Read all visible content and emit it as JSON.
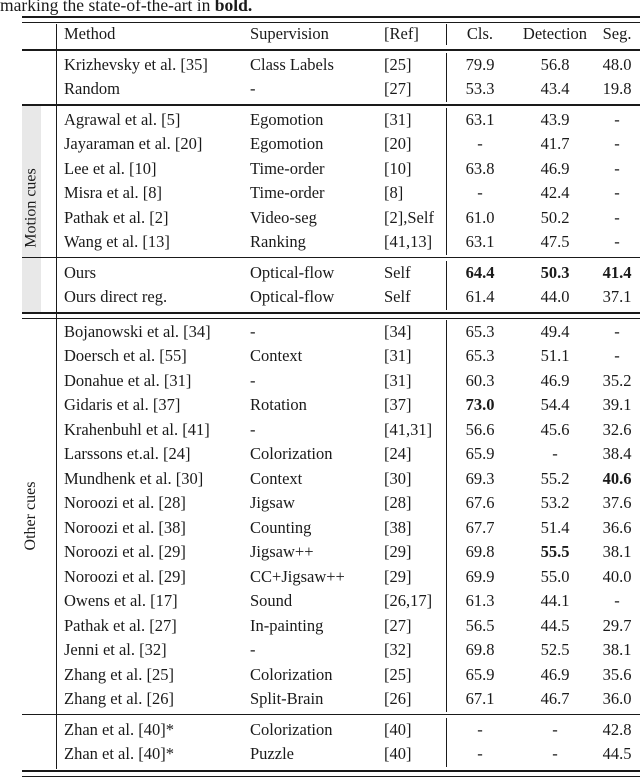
{
  "caption": {
    "prefix": "marking the state-of-the-art in ",
    "bold": "bold."
  },
  "table": {
    "columns": {
      "method": "Method",
      "supervision": "Supervision",
      "ref": "[Ref]",
      "cls": "Cls.",
      "detection": "Detection",
      "seg": "Seg."
    },
    "group_labels": {
      "motion": "Motion cues",
      "other": "Other cues"
    },
    "sections": [
      {
        "id": "supervised-baseline",
        "group": "",
        "rows": [
          {
            "method": "Krizhevsky et al. [35]",
            "supervision": "Class Labels",
            "ref": "[25]",
            "cls": "79.9",
            "detection": "56.8",
            "seg": "48.0",
            "bold": []
          },
          {
            "method": "Random",
            "supervision": "-",
            "ref": "[27]",
            "cls": "53.3",
            "detection": "43.4",
            "seg": "19.8",
            "bold": []
          }
        ]
      },
      {
        "id": "motion-cues",
        "group": "motion",
        "rows": [
          {
            "method": "Agrawal et al. [5]",
            "supervision": "Egomotion",
            "ref": "[31]",
            "cls": "63.1",
            "detection": "43.9",
            "seg": "-",
            "bold": []
          },
          {
            "method": "Jayaraman et al. [20]",
            "supervision": "Egomotion",
            "ref": "[20]",
            "cls": "-",
            "detection": "41.7",
            "seg": "-",
            "bold": []
          },
          {
            "method": "Lee et al. [10]",
            "supervision": "Time-order",
            "ref": "[10]",
            "cls": "63.8",
            "detection": "46.9",
            "seg": "-",
            "bold": []
          },
          {
            "method": "Misra et al. [8]",
            "supervision": "Time-order",
            "ref": "[8]",
            "cls": "-",
            "detection": "42.4",
            "seg": "-",
            "bold": []
          },
          {
            "method": "Pathak et al. [2]",
            "supervision": "Video-seg",
            "ref": "[2],Self",
            "cls": "61.0",
            "detection": "50.2",
            "seg": "-",
            "bold": []
          },
          {
            "method": "Wang et al. [13]",
            "supervision": "Ranking",
            "ref": "[41,13]",
            "cls": "63.1",
            "detection": "47.5",
            "seg": "-",
            "bold": []
          }
        ]
      },
      {
        "id": "ours",
        "group": "motion",
        "rows": [
          {
            "method": "Ours",
            "supervision": "Optical-flow",
            "ref": "Self",
            "cls": "64.4",
            "detection": "50.3",
            "seg": "41.4",
            "bold": [
              "cls",
              "detection",
              "seg"
            ]
          },
          {
            "method": "Ours direct reg.",
            "supervision": "Optical-flow",
            "ref": "Self",
            "cls": "61.4",
            "detection": "44.0",
            "seg": "37.1",
            "bold": []
          }
        ]
      },
      {
        "id": "other-cues",
        "group": "other",
        "rows": [
          {
            "method": "Bojanowski et al. [34]",
            "supervision": "-",
            "ref": "[34]",
            "cls": "65.3",
            "detection": "49.4",
            "seg": "-",
            "bold": []
          },
          {
            "method": "Doersch et al. [55]",
            "supervision": "Context",
            "ref": "[31]",
            "cls": "65.3",
            "detection": "51.1",
            "seg": "-",
            "bold": []
          },
          {
            "method": "Donahue et al. [31]",
            "supervision": "-",
            "ref": "[31]",
            "cls": "60.3",
            "detection": "46.9",
            "seg": "35.2",
            "bold": []
          },
          {
            "method": "Gidaris et al. [37]",
            "supervision": "Rotation",
            "ref": "[37]",
            "cls": "73.0",
            "detection": "54.4",
            "seg": "39.1",
            "bold": [
              "cls"
            ]
          },
          {
            "method": "Krahenbuhl et al. [41]",
            "supervision": "-",
            "ref": "[41,31]",
            "cls": "56.6",
            "detection": "45.6",
            "seg": "32.6",
            "bold": []
          },
          {
            "method": "Larssons et.al. [24]",
            "supervision": "Colorization",
            "ref": "[24]",
            "cls": "65.9",
            "detection": "-",
            "seg": "38.4",
            "bold": []
          },
          {
            "method": "Mundhenk et al. [30]",
            "supervision": "Context",
            "ref": "[30]",
            "cls": "69.3",
            "detection": "55.2",
            "seg": "40.6",
            "bold": [
              "seg"
            ]
          },
          {
            "method": "Noroozi et al. [28]",
            "supervision": "Jigsaw",
            "ref": "[28]",
            "cls": "67.6",
            "detection": "53.2",
            "seg": "37.6",
            "bold": []
          },
          {
            "method": "Noroozi et al. [38]",
            "supervision": "Counting",
            "ref": "[38]",
            "cls": "67.7",
            "detection": "51.4",
            "seg": "36.6",
            "bold": []
          },
          {
            "method": "Noroozi et al. [29]",
            "supervision": "Jigsaw++",
            "ref": "[29]",
            "cls": "69.8",
            "detection": "55.5",
            "seg": "38.1",
            "bold": [
              "detection"
            ]
          },
          {
            "method": "Noroozi et al. [29]",
            "supervision": "CC+Jigsaw++",
            "ref": "[29]",
            "cls": "69.9",
            "detection": "55.0",
            "seg": "40.0",
            "bold": []
          },
          {
            "method": "Owens et al. [17]",
            "supervision": "Sound",
            "ref": "[26,17]",
            "cls": "61.3",
            "detection": "44.1",
            "seg": "-",
            "bold": []
          },
          {
            "method": "Pathak et al. [27]",
            "supervision": "In-painting",
            "ref": "[27]",
            "cls": "56.5",
            "detection": "44.5",
            "seg": "29.7",
            "bold": []
          },
          {
            "method": "Jenni et al. [32]",
            "supervision": "-",
            "ref": "[32]",
            "cls": "69.8",
            "detection": "52.5",
            "seg": "38.1",
            "bold": []
          },
          {
            "method": "Zhang et al. [25]",
            "supervision": "Colorization",
            "ref": "[25]",
            "cls": "65.9",
            "detection": "46.9",
            "seg": "35.6",
            "bold": []
          },
          {
            "method": "Zhang et al. [26]",
            "supervision": "Split-Brain",
            "ref": "[26]",
            "cls": "67.1",
            "detection": "46.7",
            "seg": "36.0",
            "bold": []
          }
        ]
      },
      {
        "id": "zhan-starred",
        "group": "",
        "rows": [
          {
            "method": "Zhan et al. [40]*",
            "supervision": "Colorization",
            "ref": "[40]",
            "cls": "-",
            "detection": "-",
            "seg": "42.8",
            "bold": []
          },
          {
            "method": "Zhan et al. [40]*",
            "supervision": "Puzzle",
            "ref": "[40]",
            "cls": "-",
            "detection": "-",
            "seg": "44.5",
            "bold": []
          }
        ]
      }
    ]
  }
}
